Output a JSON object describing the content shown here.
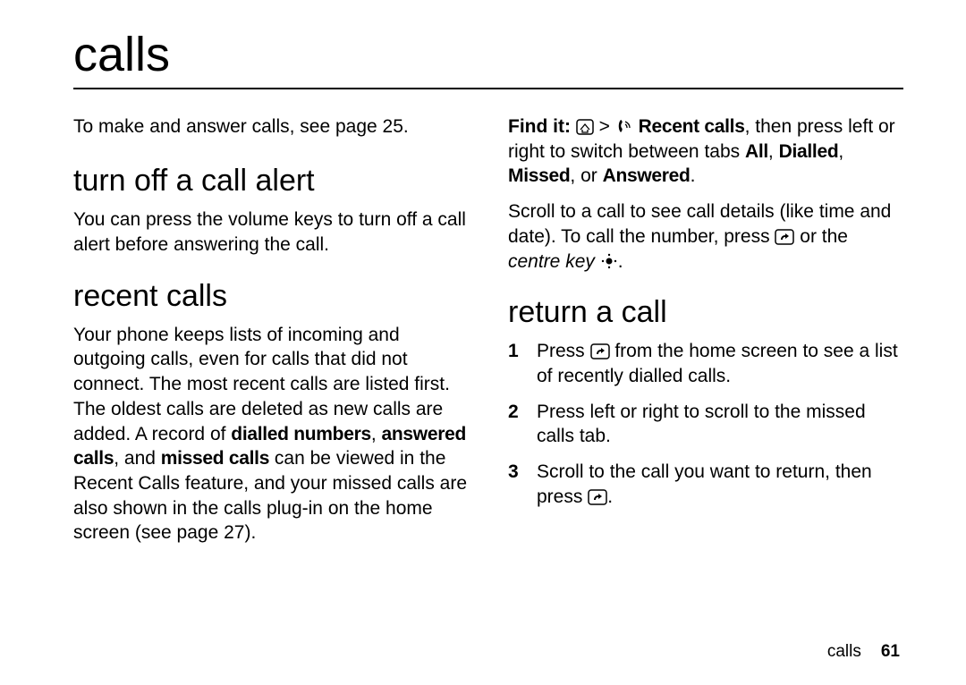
{
  "title": "calls",
  "intro_left": "To make and answer calls, see page 25.",
  "sections": {
    "turn_off": {
      "heading": "turn off a call alert",
      "body": "You can press the volume keys to turn off a call alert before answering the call."
    },
    "recent": {
      "heading": "recent calls",
      "body_a": "Your phone keeps lists of incoming and outgoing calls, even for calls that did not connect. The most recent calls are listed first. The oldest calls are deleted as new calls are added. A record of ",
      "rec_dialled": "dialled numbers",
      "sep1": ", ",
      "rec_answered": "answered calls",
      "sep2": ", and ",
      "rec_missed": "missed calls",
      "body_b": " can be viewed in the Recent Calls feature, and your missed calls are also shown in the calls plug-in on the home screen (see page 27)."
    },
    "findit": {
      "label": "Find it:",
      "gt": " > ",
      "recent_calls": "Recent calls",
      "tail_a": ", then press left or right to switch between tabs ",
      "tab_all": "All",
      "comma1": ", ",
      "tab_dialled": "Dialled",
      "comma2": ", ",
      "tab_missed": "Missed",
      "comma3": ", or ",
      "tab_answered": "Answered",
      "period": "."
    },
    "scroll": {
      "a": "Scroll to a call to see call details (like time and date). To call the number, press ",
      "b": " or the ",
      "centre": "centre key",
      "c": " "
    },
    "return": {
      "heading": "return a call",
      "step1a": "Press ",
      "step1b": " from the home screen to see a list of recently dialled calls.",
      "step2": "Press left or right to scroll to the missed calls tab.",
      "step3a": "Scroll to the call you want to return, then press ",
      "step3b": ".",
      "n1": "1",
      "n2": "2",
      "n3": "3"
    }
  },
  "footer": {
    "section": "calls",
    "page": "61"
  }
}
